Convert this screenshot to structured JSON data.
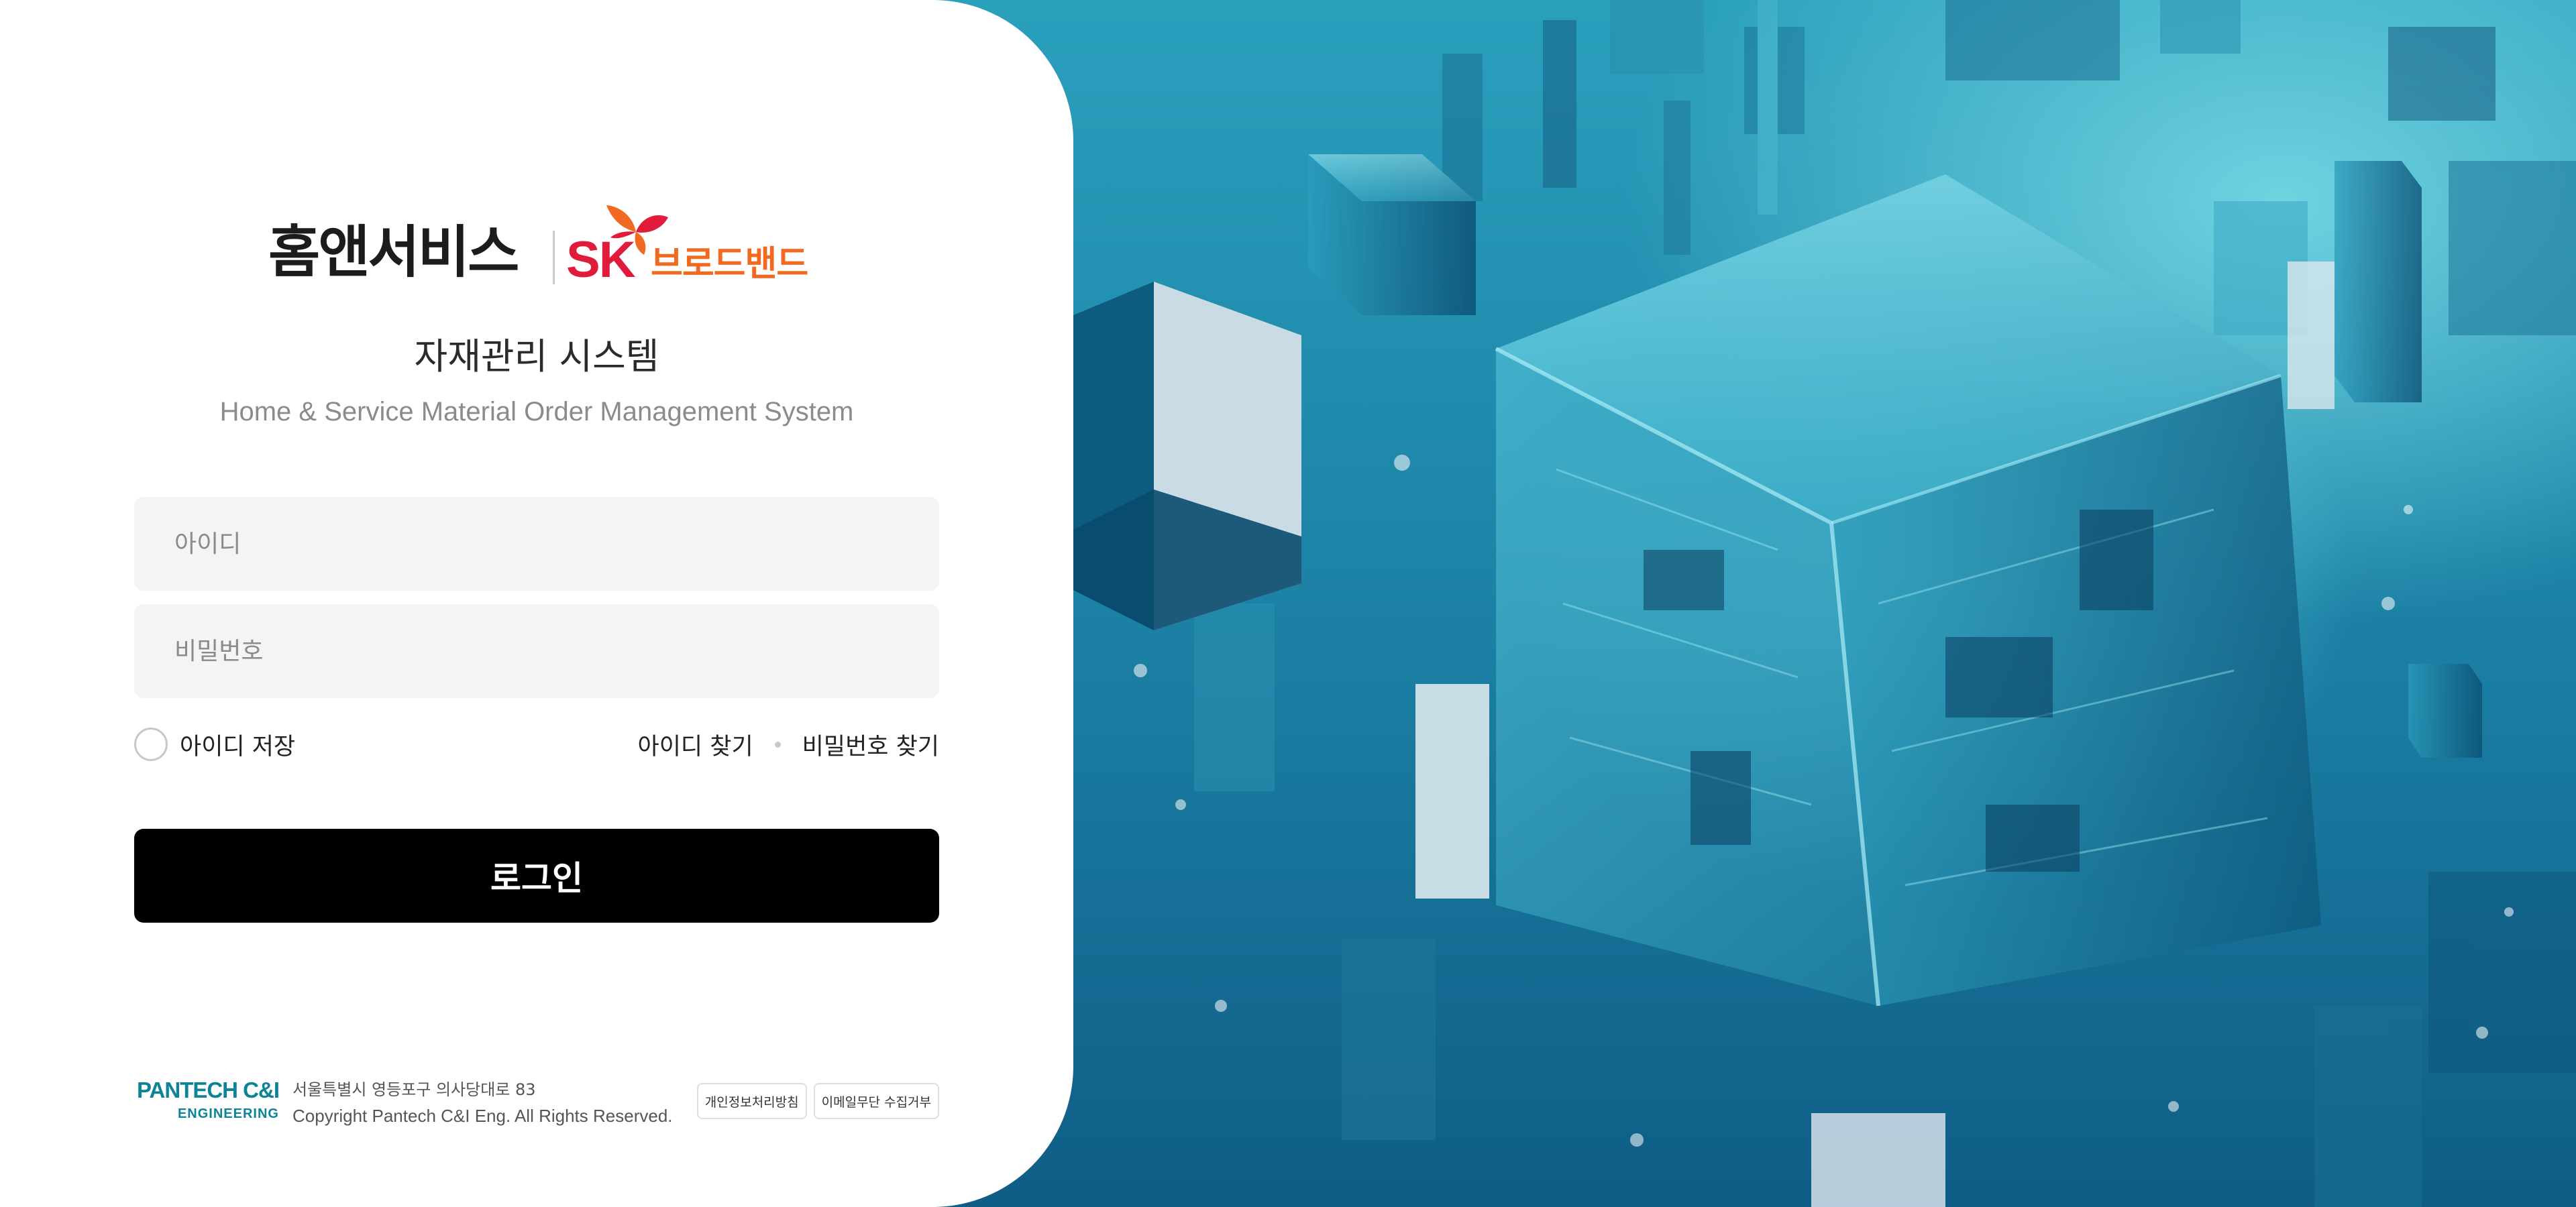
{
  "brand": {
    "home_service": "홈앤서비스",
    "sk": "SK",
    "broadband": "브로드밴드"
  },
  "title": "자재관리 시스템",
  "subtitle": "Home & Service Material Order Management System",
  "form": {
    "id_placeholder": "아이디",
    "password_placeholder": "비밀번호",
    "remember_label": "아이디 저장",
    "remember_checked": false,
    "find_id_label": "아이디 찾기",
    "find_password_label": "비밀번호 찾기",
    "login_label": "로그인"
  },
  "footer": {
    "company_main": "PANTECH C&I",
    "company_sub": "ENGINEERING",
    "address": "서울특별시 영등포구 의사당대로 83",
    "copyright": "Copyright Pantech C&I Eng. All Rights Reserved.",
    "privacy_policy_label": "개인정보처리방침",
    "email_refusal_label": "이메일무단 수집거부"
  },
  "colors": {
    "sk_red": "#e11b3a",
    "sk_orange": "#f26a21",
    "pantech_teal": "#0c8397",
    "login_button": "#000000",
    "hero_blue": "#1f8fb0"
  },
  "icons": {
    "logo_mark": "sk-butterfly-icon",
    "remember_control": "radio-circle-icon"
  }
}
